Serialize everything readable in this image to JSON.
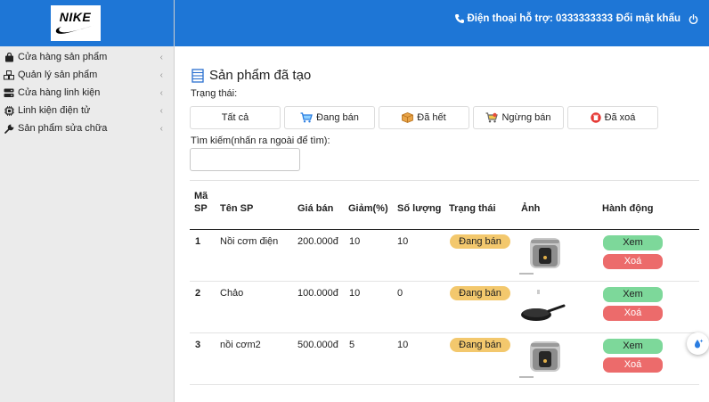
{
  "sidebar": {
    "logo_text": "NIKE",
    "items": [
      {
        "label": "Cửa hàng sản phẩm",
        "icon": "shopping-bag-icon"
      },
      {
        "label": "Quản lý sản phẩm",
        "icon": "cubes-icon"
      },
      {
        "label": "Cửa hàng linh kiện",
        "icon": "server-icon"
      },
      {
        "label": "Linh kiện điện tử",
        "icon": "chip-icon"
      },
      {
        "label": "Sản phẩm sửa chữa",
        "icon": "wrench-icon"
      }
    ]
  },
  "topbar": {
    "support_text": "Điện thoại hỗ trợ: 0333333333",
    "change_password": "Đổi mật khẩu",
    "colors": {
      "header": "#1e76d6"
    }
  },
  "main": {
    "title": "Sản phẩm đã tạo",
    "status_label": "Trạng thái:",
    "filters": [
      {
        "label": "Tất cả",
        "icon": ""
      },
      {
        "label": "Đang bán",
        "icon": "cart-icon"
      },
      {
        "label": "Đã hết",
        "icon": "box-icon"
      },
      {
        "label": "Ngừng bán",
        "icon": "stop-cart-icon"
      },
      {
        "label": "Đã xoá",
        "icon": "trash-icon"
      }
    ],
    "search_label": "Tìm kiếm(nhấn ra ngoài để tìm):",
    "search_value": ""
  },
  "table": {
    "headers": {
      "id": "Mã SP",
      "name": "Tên SP",
      "price": "Giá bán",
      "discount": "Giảm(%)",
      "qty": "Số lượng",
      "status": "Trạng thái",
      "image": "Ảnh",
      "actions": "Hành động"
    },
    "rows": [
      {
        "id": "1",
        "name": "Nồi cơm điện",
        "price": "200.000đ",
        "discount": "10",
        "qty": "10",
        "status": "Đang bán",
        "image": "rice-cooker"
      },
      {
        "id": "2",
        "name": "Chảo",
        "price": "100.000đ",
        "discount": "10",
        "qty": "0",
        "status": "Đang bán",
        "image": "frying-pan"
      },
      {
        "id": "3",
        "name": "nồi cơm2",
        "price": "500.000đ",
        "discount": "5",
        "qty": "10",
        "status": "Đang bán",
        "image": "rice-cooker"
      }
    ],
    "view_label": "Xem",
    "delete_label": "Xoá",
    "colors": {
      "badge": "#f3c86d",
      "view": "#7dd89a",
      "delete": "#ec6b6b"
    }
  }
}
